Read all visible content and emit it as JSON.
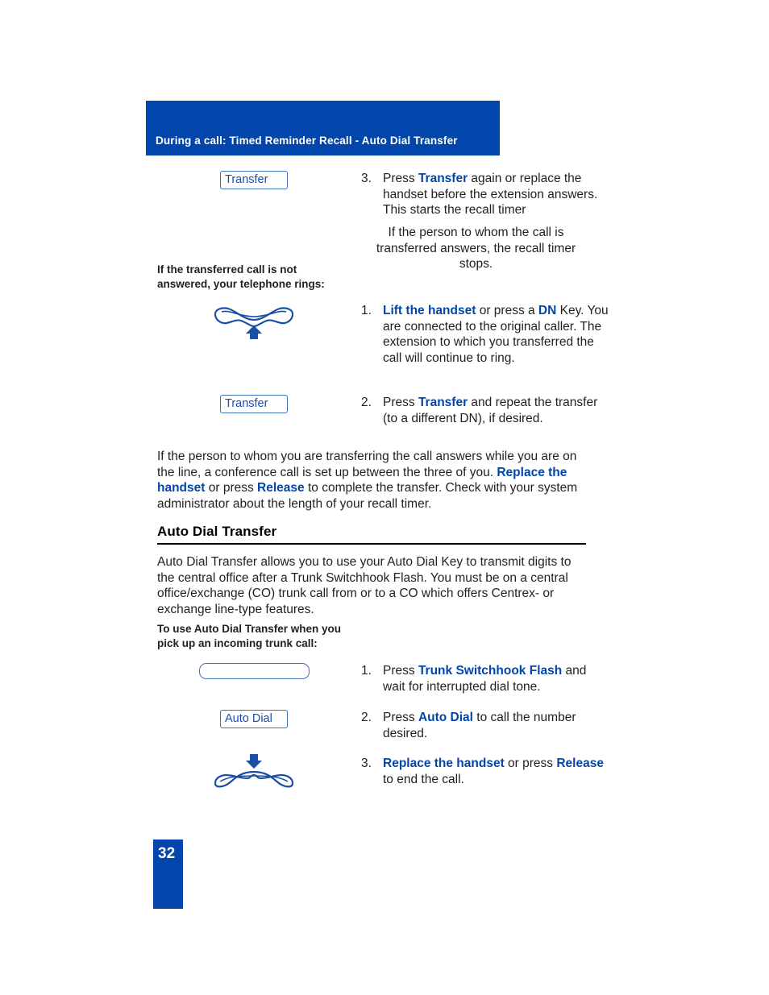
{
  "header": {
    "title": "During a call: Timed Reminder Recall - Auto Dial Transfer",
    "background_color": "#0346ab",
    "text_color": "#ffffff"
  },
  "colors": {
    "accent_blue": "#0346ab",
    "key_border_blue": "#3f6fb5",
    "key_text_blue": "#1b4ea8",
    "body_text": "#231f20"
  },
  "keys": {
    "transfer": "Transfer",
    "auto_dial": "Auto Dial",
    "blank": ""
  },
  "steps": {
    "step3_transfer": {
      "number": "3.",
      "text_before": "Press ",
      "keyword": "Transfer",
      "text_after": " again or replace the handset before the extension answers. This starts the recall timer"
    },
    "recall_note": "If the person to whom the call is transferred answers, the recall timer stops.",
    "lift_handset": {
      "number": "1.",
      "keyword1": "Lift the handset",
      "mid": " or press a ",
      "keyword2": "DN",
      "text_after": " Key. You are connected to the original caller. The extension to which you transferred the call will continue to ring."
    },
    "repeat_transfer": {
      "number": "2.",
      "text_before": "Press ",
      "keyword": "Transfer",
      "text_after": " and repeat the transfer (to a different DN), if desired."
    },
    "trunk_flash": {
      "number": "1.",
      "text_before": "Press ",
      "keyword": "Trunk Switchhook Flash",
      "text_after": " and wait for interrupted dial tone."
    },
    "auto_dial_step": {
      "number": "2.",
      "text_before": "Press ",
      "keyword": "Auto Dial",
      "text_after": " to call the number desired."
    },
    "replace_handset": {
      "number": "3.",
      "keyword1": "Replace the handset",
      "mid": " or press ",
      "keyword2": "Release",
      "text_after": " to end the call."
    }
  },
  "captions": {
    "not_answered": "If the transferred call is not answered, your telephone rings:",
    "to_use_auto_dial": "To use Auto Dial Transfer when you pick up an incoming trunk call:"
  },
  "paragraphs": {
    "conference": {
      "part1": "If the person to whom you are transferring the call answers while you are on the line, a conference call is set up between the three of you. ",
      "keyword1": "Replace the handset",
      "part2": " or press ",
      "keyword2": "Release",
      "part3": " to complete the transfer. Check with your system administrator about the length of your recall timer."
    },
    "auto_dial_intro": "Auto Dial Transfer allows you to use your Auto Dial Key to transmit digits to the central office after a Trunk Switchhook Flash. You must be on a central office/exchange (CO) trunk call from or to a CO which offers Centrex- or exchange line-type features."
  },
  "section": {
    "auto_dial_transfer_heading": "Auto Dial Transfer"
  },
  "footer": {
    "page_number": "32"
  },
  "icons": {
    "lift_handset": "handset-up-arrow-icon",
    "replace_handset": "handset-down-arrow-icon"
  }
}
